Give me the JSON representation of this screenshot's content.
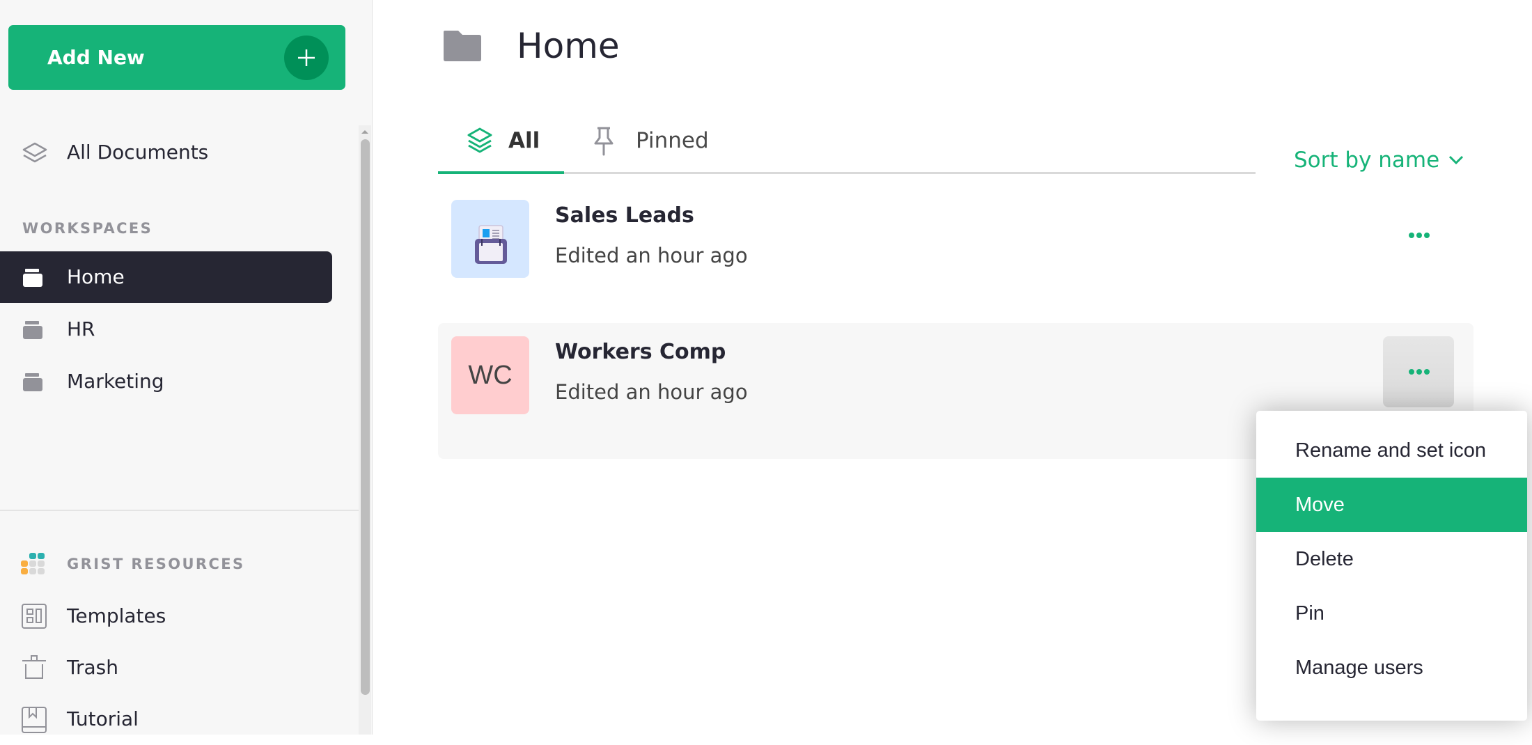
{
  "sidebar": {
    "add_new_label": "Add New",
    "all_documents_label": "All Documents",
    "workspaces_heading": "WORKSPACES",
    "workspaces": [
      {
        "label": "Home",
        "active": true
      },
      {
        "label": "HR",
        "active": false
      },
      {
        "label": "Marketing",
        "active": false
      }
    ],
    "resources_heading": "GRIST RESOURCES",
    "resources": [
      {
        "label": "Templates",
        "icon": "templates-icon"
      },
      {
        "label": "Trash",
        "icon": "trash-icon"
      },
      {
        "label": "Tutorial",
        "icon": "tutorial-book-icon"
      }
    ]
  },
  "main": {
    "title": "Home",
    "tabs": [
      {
        "label": "All",
        "icon": "layers-icon",
        "selected": true
      },
      {
        "label": "Pinned",
        "icon": "pin-icon",
        "selected": false
      }
    ],
    "sort_label": "Sort by name",
    "documents": [
      {
        "name": "Sales Leads",
        "edited": "Edited an hour ago",
        "thumbnail": "rolodex-icon",
        "thumb_color": "#d5e7ff"
      },
      {
        "name": "Workers Comp",
        "edited": "Edited an hour ago",
        "initials": "WC",
        "thumb_color": "#ffcdcf"
      }
    ]
  },
  "context_menu": {
    "items": [
      {
        "label": "Rename and set icon",
        "highlighted": false
      },
      {
        "label": "Move",
        "highlighted": true
      },
      {
        "label": "Delete",
        "highlighted": false
      },
      {
        "label": "Pin",
        "highlighted": false
      },
      {
        "label": "Manage users",
        "highlighted": false
      }
    ]
  },
  "colors": {
    "accent": "#16b378",
    "accent_dark": "#009058",
    "active_nav_bg": "#262633",
    "sidebar_bg": "#f7f7f7"
  }
}
